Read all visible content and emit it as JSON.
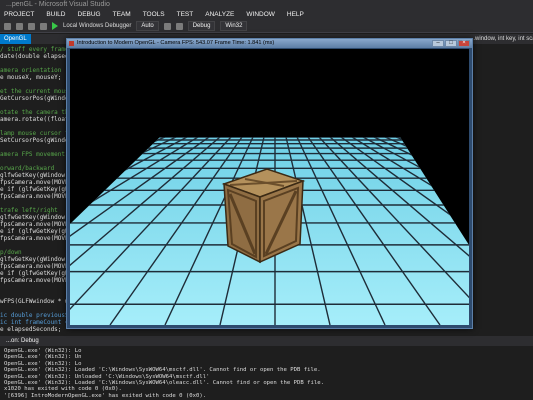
{
  "vs": {
    "title": "...penGL - Microsoft Visual Studio",
    "menu": [
      "PROJECT",
      "BUILD",
      "DEBUG",
      "TEAM",
      "TOOLS",
      "TEST",
      "ANALYZE",
      "WINDOW",
      "HELP"
    ],
    "toolbar": {
      "debugger_label": "Local Windows Debugger",
      "auto_label": "Auto",
      "config_label": "Debug",
      "platform_label": "Win32"
    },
    "doc_tab": "OpenGL",
    "right_tab": "...window, int key, int scancode,"
  },
  "code": [
    {
      "text": "/ stuff every frame",
      "style": "comment"
    },
    {
      "text": "date(double elapsedTime)",
      "style": "code"
    },
    {
      "text": "",
      "style": "code"
    },
    {
      "text": "amera orientation",
      "style": "comment"
    },
    {
      "text": "e mouseX, mouseY;",
      "style": "code"
    },
    {
      "text": "",
      "style": "code"
    },
    {
      "text": "et the current mouse cu",
      "style": "comment"
    },
    {
      "text": "GetCursorPos(gWindow, &m",
      "style": "code"
    },
    {
      "text": "",
      "style": "code"
    },
    {
      "text": "otate the camera the di",
      "style": "comment"
    },
    {
      "text": "amera.rotate((float)(gW",
      "style": "code"
    },
    {
      "text": "",
      "style": "code"
    },
    {
      "text": "lamp mouse cursor to cen",
      "style": "comment"
    },
    {
      "text": "SetCursorPos(gWindow, gW",
      "style": "code"
    },
    {
      "text": "",
      "style": "code"
    },
    {
      "text": "amera FPS movement",
      "style": "comment"
    },
    {
      "text": "",
      "style": "code"
    },
    {
      "text": "orward/backward",
      "style": "comment"
    },
    {
      "text": "glfwGetKey(gWindow, GLFW",
      "style": "code"
    },
    {
      "text": "fpsCamera.move(MOVE_SPEED",
      "style": "code"
    },
    {
      "text": "e if (glfwGetKey(gWindow",
      "style": "code"
    },
    {
      "text": "fpsCamera.move(MOVE_SPEED",
      "style": "code"
    },
    {
      "text": "",
      "style": "code"
    },
    {
      "text": "trafe left/right",
      "style": "comment"
    },
    {
      "text": "glfwGetKey(gWindow, GLFW",
      "style": "code"
    },
    {
      "text": "fpsCamera.move(MOVE_SPEED",
      "style": "code"
    },
    {
      "text": "e if (glfwGetKey(gWindow",
      "style": "code"
    },
    {
      "text": "fpsCamera.move(MOVE_SPEED",
      "style": "code"
    },
    {
      "text": "",
      "style": "code"
    },
    {
      "text": "p/down",
      "style": "comment"
    },
    {
      "text": "glfwGetKey(gWindow, GLFW",
      "style": "code"
    },
    {
      "text": "fpsCamera.move(MOVE_SPEED",
      "style": "code"
    },
    {
      "text": "e if (glfwGetKey(gWindow",
      "style": "code"
    },
    {
      "text": "fpsCamera.move(MOVE_SPEED",
      "style": "code"
    },
    {
      "text": "",
      "style": "code"
    },
    {
      "text": "",
      "style": "code"
    },
    {
      "text": "wFPS(GLFWwindow * window",
      "style": "code"
    },
    {
      "text": "",
      "style": "code"
    },
    {
      "text": "ic double previousSeconds",
      "style": "kw"
    },
    {
      "text": "ic int frameCount = 0;",
      "style": "kw"
    },
    {
      "text": "e elapsedSeconds;",
      "style": "code"
    }
  ],
  "app_window": {
    "title": "Introduction to Modern OpenGL - Camera    FPS: 543.07    Frame Time: 1.841 (ms)"
  },
  "output": {
    "header": "...on: Debug",
    "lines": [
      "OpenGL.exe' (Win32): Lo",
      "OpenGL.exe' (Win32): Un",
      "OpenGL.exe' (Win32): Lo",
      "OpenGL.exe' (Win32): Loaded 'C:\\Windows\\SysWOW64\\msctf.dll'. Cannot find or open the PDB file.",
      "OpenGL.exe' (Win32): Unloaded 'C:\\Windows\\SysWOW64\\msctf.dll'",
      "OpenGL.exe' (Win32): Loaded 'C:\\Windows\\SysWOW64\\oleacc.dll'. Cannot find or open the PDB file.",
      "x1020 has exited with code 0 (0x0).",
      "'[6396] IntroModernOpenGL.exe' has exited with code 0 (0x0)."
    ]
  },
  "colors": {
    "floor": "#8fe4f4",
    "grid": "#1e2c38",
    "sky": "#000000",
    "crate_light": "#a88756",
    "crate_dark": "#5c4426"
  }
}
